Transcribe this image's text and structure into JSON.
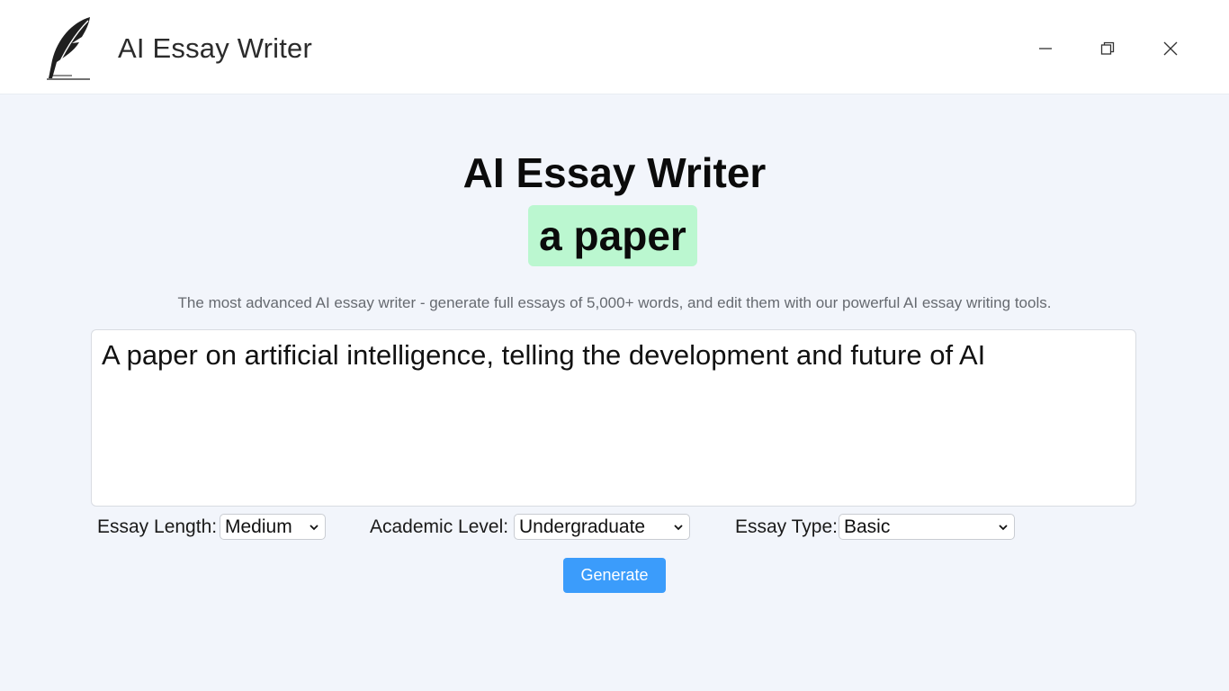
{
  "window": {
    "title": "AI Essay Writer",
    "logo_icon": "feather-quill-icon",
    "controls": [
      "minimize-icon",
      "restore-icon",
      "close-icon"
    ]
  },
  "hero": {
    "title": "AI Essay Writer",
    "highlight": "a paper",
    "highlight_color": "#bbf7d0",
    "subtitle": "The most advanced AI essay writer - generate full essays of 5,000+ words, and edit them with our powerful AI essay writing tools."
  },
  "prompt": {
    "value": "A paper on artificial intelligence, telling the development and future of AI"
  },
  "options": {
    "length_label": "Essay Length:",
    "length_value": "Medium",
    "level_label": "Academic Level:",
    "level_value": "Undergraduate",
    "type_label": "Essay Type:",
    "type_value": "Basic"
  },
  "actions": {
    "generate_label": "Generate",
    "accent_color": "#3b9cfb"
  }
}
